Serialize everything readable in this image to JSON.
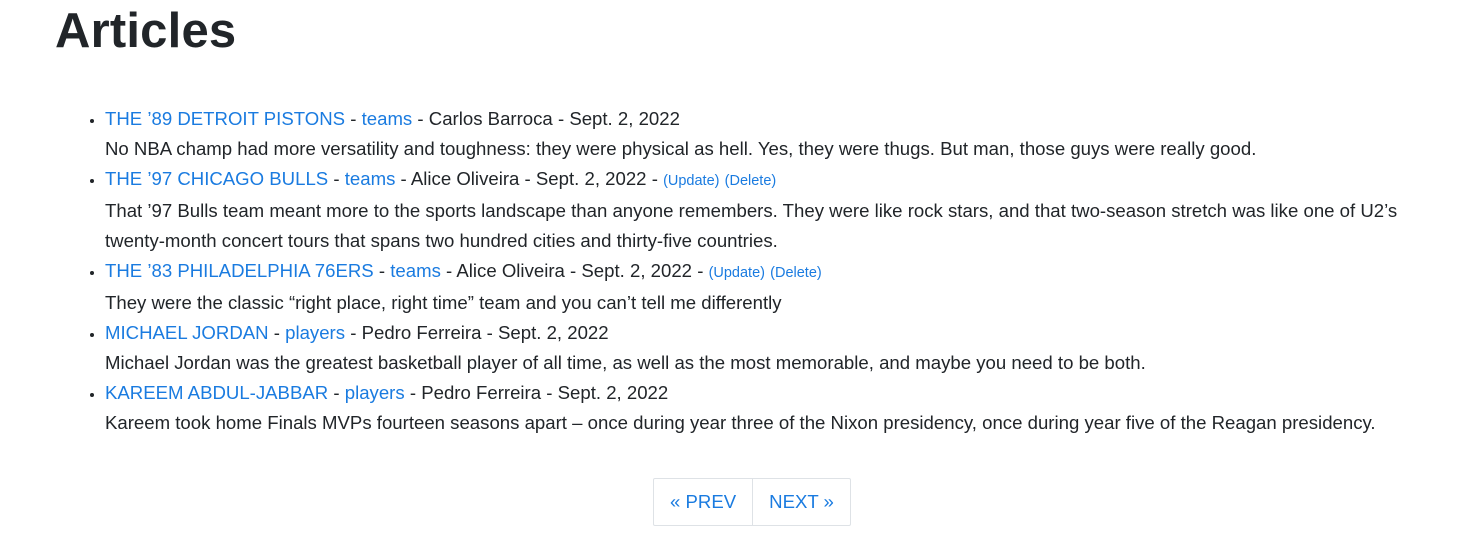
{
  "page": {
    "title": "Articles"
  },
  "separator": " - ",
  "articles": [
    {
      "title": "THE ’89 DETROIT PISTONS",
      "category": "teams",
      "author": "Carlos Barroca",
      "date": "Sept. 2, 2022",
      "description": "No NBA champ had more versatility and toughness: they were physical as hell. Yes, they were thugs. But man, those guys were really good."
    },
    {
      "title": "THE ’97 CHICAGO BULLS",
      "category": "teams",
      "author": "Alice Oliveira",
      "date": "Sept. 2, 2022",
      "update_label": "(Update)",
      "delete_label": "(Delete)",
      "description": "That ’97 Bulls team meant more to the sports landscape than anyone remembers. They were like rock stars, and that two-season stretch was like one of U2’s twenty-month concert tours that spans two hundred cities and thirty-five countries."
    },
    {
      "title": "THE ’83 PHILADELPHIA 76ERS",
      "category": "teams",
      "author": "Alice Oliveira",
      "date": "Sept. 2, 2022",
      "update_label": "(Update)",
      "delete_label": "(Delete)",
      "description": "They were the classic “right place, right time” team and you can’t tell me differently"
    },
    {
      "title": "MICHAEL JORDAN",
      "category": "players",
      "author": "Pedro Ferreira",
      "date": "Sept. 2, 2022",
      "description": "Michael Jordan was the greatest basketball player of all time, as well as the most memorable, and maybe you need to be both."
    },
    {
      "title": "KAREEM ABDUL-JABBAR",
      "category": "players",
      "author": "Pedro Ferreira",
      "date": "Sept. 2, 2022",
      "description": "Kareem took home Finals MVPs fourteen seasons apart – once during year three of the Nixon presidency, once during year five of the Reagan presidency."
    }
  ],
  "pagination": {
    "prev_label": "« PREV",
    "next_label": "NEXT »"
  },
  "colors": {
    "link": "#1a7be0",
    "text": "#212529",
    "border": "#dee2e6"
  }
}
